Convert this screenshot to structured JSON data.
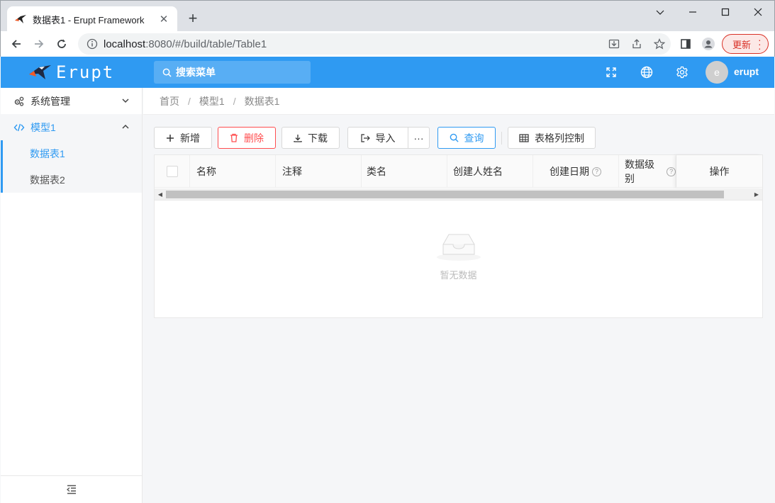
{
  "browser": {
    "tab_title": "数据表1 - Erupt Framework",
    "url_host": "localhost",
    "url_path": ":8080/#/build/table/Table1",
    "update_label": "更新"
  },
  "header": {
    "logo_text": "Erupt",
    "search_placeholder": "搜索菜单",
    "avatar_letter": "e",
    "username": "erupt",
    "brand_color": "#2f9af2"
  },
  "sidebar": {
    "items": [
      {
        "label": "系统管理",
        "icon": "gears-icon",
        "expanded": false
      },
      {
        "label": "模型1",
        "icon": "code-icon",
        "expanded": true,
        "children": [
          {
            "label": "数据表1",
            "active": true
          },
          {
            "label": "数据表2",
            "active": false
          }
        ]
      }
    ]
  },
  "breadcrumb": [
    "首页",
    "模型1",
    "数据表1"
  ],
  "toolbar": {
    "add": "新增",
    "delete": "删除",
    "download": "下载",
    "import": "导入",
    "more": "···",
    "query": "查询",
    "columns": "表格列控制"
  },
  "table": {
    "columns": [
      "名称",
      "注释",
      "类名",
      "创建人姓名",
      "创建日期",
      "数据级别",
      "操作"
    ],
    "empty_text": "暂无数据"
  }
}
